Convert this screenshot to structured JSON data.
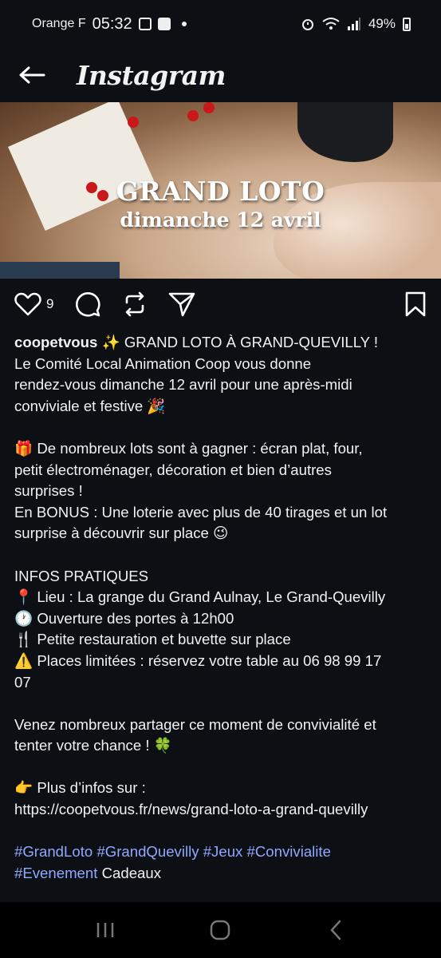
{
  "status_bar": {
    "carrier": "Orange F",
    "time": "05:32",
    "battery": "49%",
    "icons": [
      "gallery-icon",
      "check-icon",
      "dot-icon",
      "alarm-icon",
      "wifi-icon",
      "signal-icon",
      "battery-icon"
    ]
  },
  "header": {
    "title": "Instagram",
    "back_icon": "back-arrow-icon"
  },
  "post_image": {
    "line1": "GRAND LOTO",
    "line2": "dimanche 12 avril"
  },
  "actions": {
    "like_count": "9",
    "icons": [
      "heart-icon",
      "comment-icon",
      "repost-icon",
      "share-icon",
      "bookmark-icon"
    ]
  },
  "caption": {
    "username": "coopetvous",
    "lines": [
      " ✨ GRAND LOTO À GRAND-QUEVILLY !",
      "Le Comité Local Animation Coop vous donne",
      "rendez-vous dimanche 12 avril pour une après-midi",
      "conviviale et festive 🎉",
      "",
      "🎁 De nombreux lots sont à gagner : écran plat, four,",
      "petit électroménager, décoration et bien d’autres",
      "surprises !",
      "En BONUS : Une loterie avec plus de 40 tirages et un lot",
      "surprise à découvrir sur place 😉",
      "",
      "INFOS PRATIQUES",
      "📍 Lieu : La grange du Grand Aulnay, Le Grand-Quevilly",
      "🕐 Ouverture des portes à 12h00",
      "🍴 Petite restauration et buvette sur place",
      "⚠️ Places limitées : réservez votre table au 06 98 99 17",
      "07",
      "",
      "Venez nombreux partager ce moment de convivialité et",
      "tenter votre chance ! 🍀",
      "",
      "👉 Plus d’infos sur :",
      "https://coopetvous.fr/news/grand-loto-a-grand-quevilly",
      ""
    ],
    "hashtags_line1": [
      "#GrandLoto",
      "#GrandQuevilly",
      "#Jeux",
      "#Convivialite"
    ],
    "hashtags_line2": [
      "#Evenement"
    ],
    "trailing_text": "Cadeaux"
  },
  "navbar": {
    "icons": [
      "recent-apps-icon",
      "home-icon",
      "back-icon"
    ]
  },
  "colors": {
    "background": "#0c0f14",
    "hashtag": "#91a8ff",
    "text": "#f2f2f2"
  }
}
